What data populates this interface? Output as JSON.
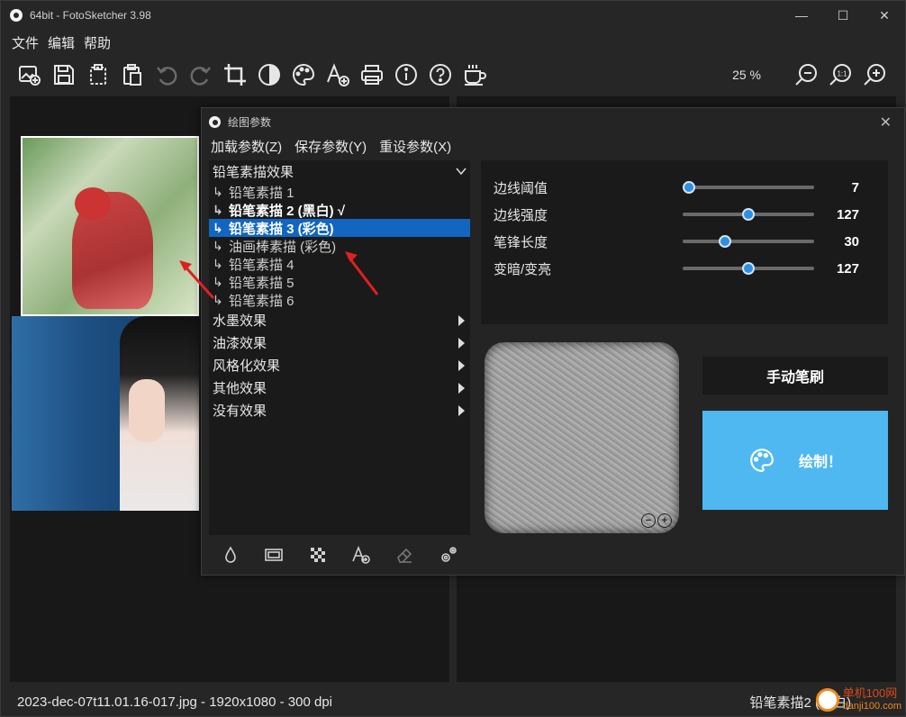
{
  "window": {
    "title": "64bit - FotoSketcher 3.98",
    "controls": [
      "—",
      "☐",
      "✕"
    ]
  },
  "menu": [
    "文件",
    "编辑",
    "帮助"
  ],
  "toolbar": {
    "icons": [
      "open-image-icon",
      "save-icon",
      "copy-icon",
      "paste-icon",
      "undo-icon",
      "redo-icon",
      "crop-icon",
      "contrast-icon",
      "palette-icon",
      "add-text-icon",
      "print-icon",
      "info-icon",
      "help-icon",
      "coffee-icon"
    ],
    "zoom_label": "25 %"
  },
  "status": {
    "file_info": "2023-dec-07t11.01.16-017.jpg - 1920x1080 - 300 dpi",
    "effect": "铅笔素描2 (黑白)"
  },
  "watermark": {
    "brand": "单机100网",
    "url": "danji100.com"
  },
  "dialog": {
    "title": "绘图参数",
    "menu": [
      "加载参数(Z)",
      "保存参数(Y)",
      "重设参数(X)"
    ],
    "groups": [
      {
        "label": "铅笔素描效果",
        "expanded": true
      },
      {
        "label": "水墨效果"
      },
      {
        "label": "油漆效果"
      },
      {
        "label": "风格化效果"
      },
      {
        "label": "其他效果"
      },
      {
        "label": "没有效果"
      }
    ],
    "items": [
      {
        "label": "铅笔素描 1"
      },
      {
        "label": "铅笔素描 2 (黑白) √"
      },
      {
        "label": "铅笔素描 3 (彩色)"
      },
      {
        "label": "油画棒素描 (彩色)"
      },
      {
        "label": "铅笔素描 4"
      },
      {
        "label": "铅笔素描 5"
      },
      {
        "label": "铅笔素描 6"
      }
    ],
    "params": [
      {
        "label": "边线阈值",
        "value": "7",
        "fraction": 0.05
      },
      {
        "label": "边线强度",
        "value": "127",
        "fraction": 0.5
      },
      {
        "label": "笔锋长度",
        "value": "30",
        "fraction": 0.32
      },
      {
        "label": "变暗/变亮",
        "value": "127",
        "fraction": 0.5
      }
    ],
    "manual_brush": "手动笔刷",
    "draw": "绘制！",
    "bottom_icons": [
      "water-drop-icon",
      "frame-icon",
      "texture-icon",
      "add-text-icon",
      "eraser-icon",
      "settings-gears-icon"
    ],
    "accent_color": "#4fb8f0",
    "selection_color": "#1266c0"
  }
}
